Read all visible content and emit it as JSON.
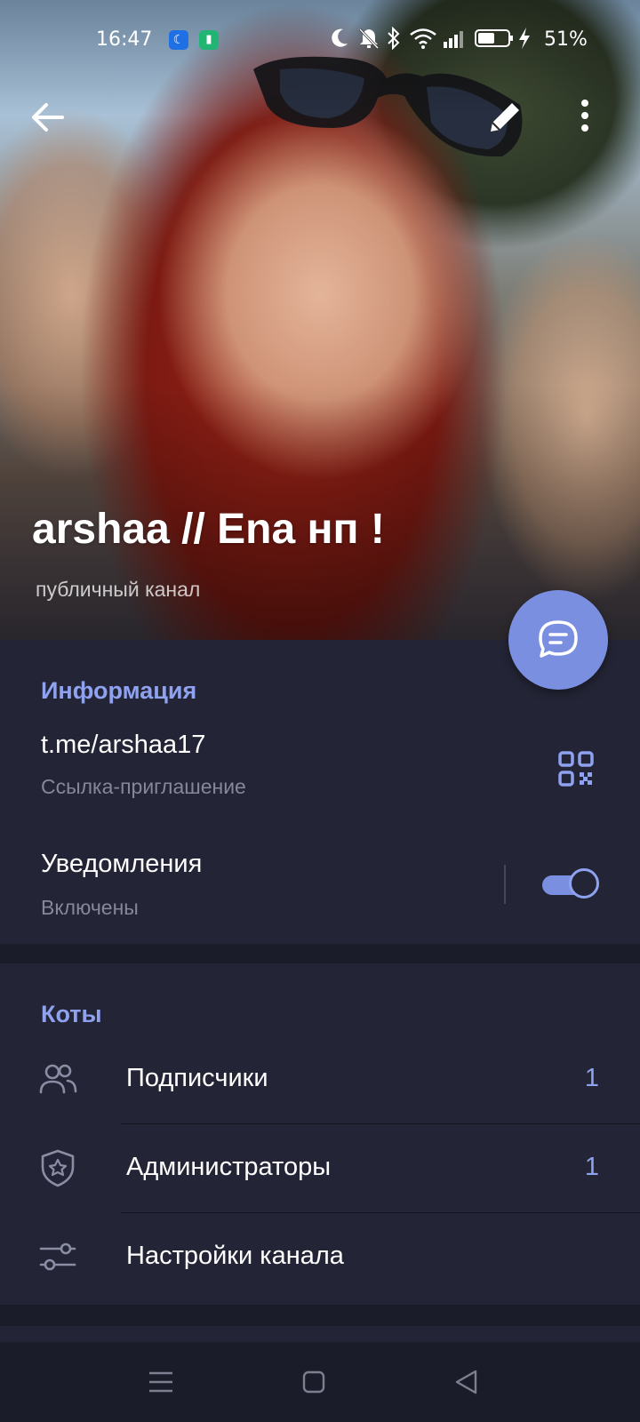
{
  "status_bar": {
    "time": "16:47",
    "battery": "51%",
    "icons": [
      "moon-icon",
      "bell-off-icon",
      "bluetooth-icon",
      "wifi-icon",
      "signal-icon",
      "battery-icon",
      "charging-icon"
    ]
  },
  "header": {
    "title": "arshaa // Ena нп !",
    "subtitle": "публичный канал"
  },
  "info": {
    "section_title": "Информация",
    "link": "t.me/arshaa17",
    "link_caption": "Ссылка-приглашение",
    "notifications_label": "Уведомления",
    "notifications_status": "Включены",
    "notifications_enabled": true
  },
  "members": {
    "section_title": "Коты",
    "items": [
      {
        "icon": "users-icon",
        "label": "Подписчики",
        "count": "1"
      },
      {
        "icon": "shield-star-icon",
        "label": "Администраторы",
        "count": "1"
      },
      {
        "icon": "sliders-icon",
        "label": "Настройки канала",
        "count": ""
      }
    ]
  },
  "colors": {
    "accent": "#8fa2f0",
    "fab": "#7b8fe0",
    "background": "#1b1c2a",
    "card": "#232435"
  }
}
